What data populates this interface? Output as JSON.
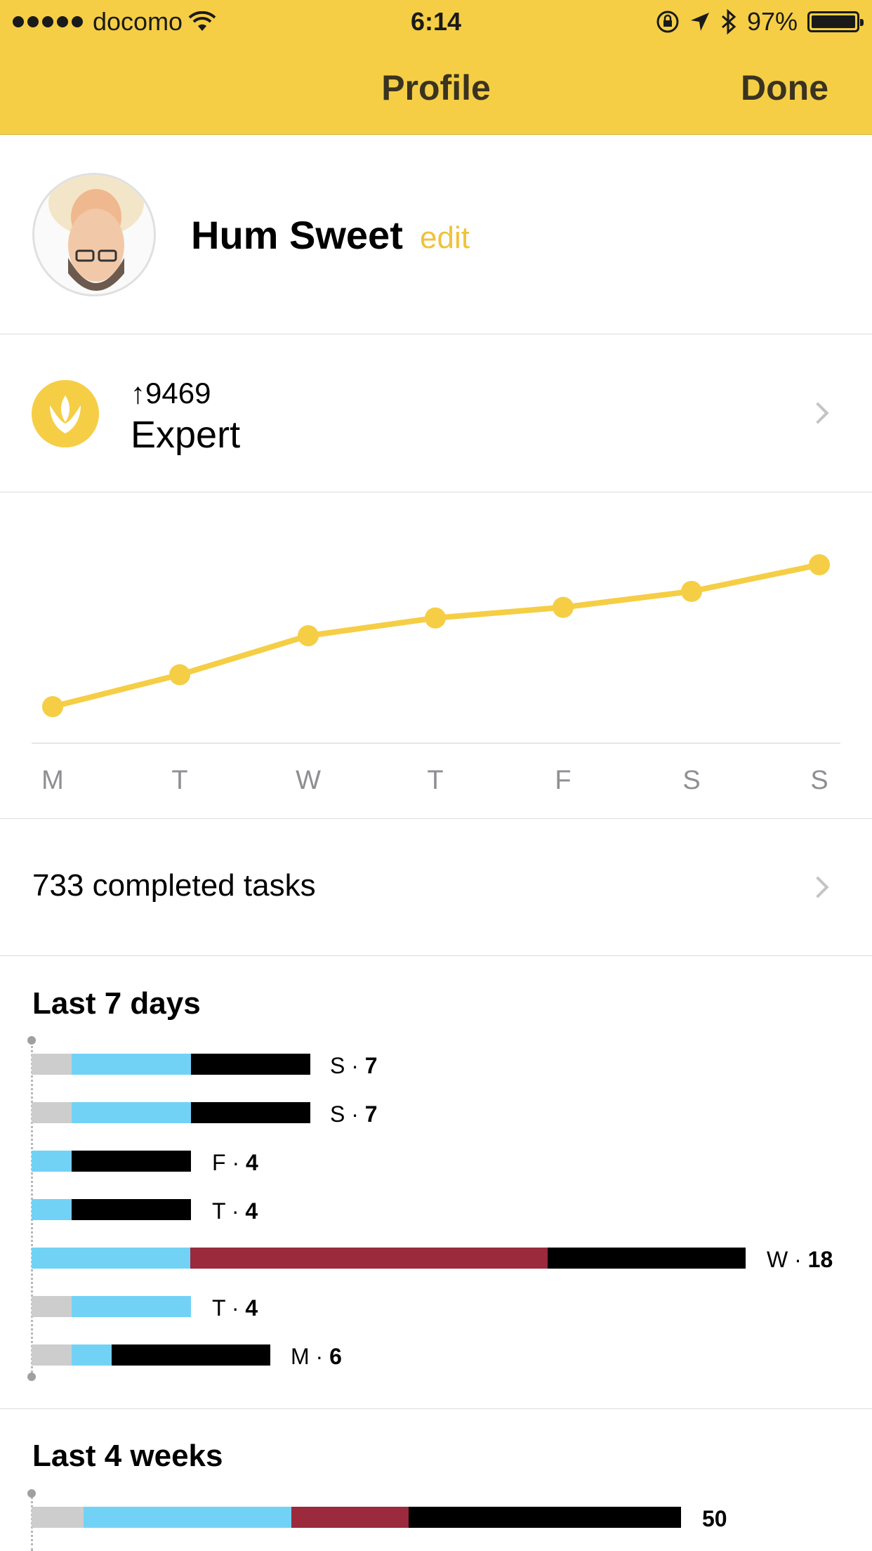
{
  "status_bar": {
    "carrier": "docomo",
    "time": "6:14",
    "battery": "97%"
  },
  "nav": {
    "title": "Profile",
    "done": "Done"
  },
  "profile": {
    "name": "Hum Sweet",
    "edit": "edit"
  },
  "level": {
    "points": "↑9469",
    "rank": "Expert"
  },
  "chart_data": {
    "type": "line",
    "categories": [
      "M",
      "T",
      "W",
      "T",
      "F",
      "S",
      "S"
    ],
    "values": [
      0,
      0.18,
      0.4,
      0.5,
      0.56,
      0.65,
      0.8
    ],
    "color": "#F5CE45"
  },
  "tasks": {
    "label": "733 completed tasks"
  },
  "last7": {
    "title": "Last 7 days",
    "rows": [
      {
        "day": "S",
        "count": "7"
      },
      {
        "day": "S",
        "count": "7"
      },
      {
        "day": "F",
        "count": "4"
      },
      {
        "day": "T",
        "count": "4"
      },
      {
        "day": "W",
        "count": "18"
      },
      {
        "day": "T",
        "count": "4"
      },
      {
        "day": "M",
        "count": "6"
      }
    ]
  },
  "last4": {
    "title": "Last 4 weeks",
    "rows": [
      {
        "count": "50"
      }
    ]
  },
  "colors": {
    "accent": "#F5CE45",
    "blue": "#72D2F6",
    "red": "#9A2A3C",
    "gray": "#CDCDCD",
    "black": "#000000"
  }
}
